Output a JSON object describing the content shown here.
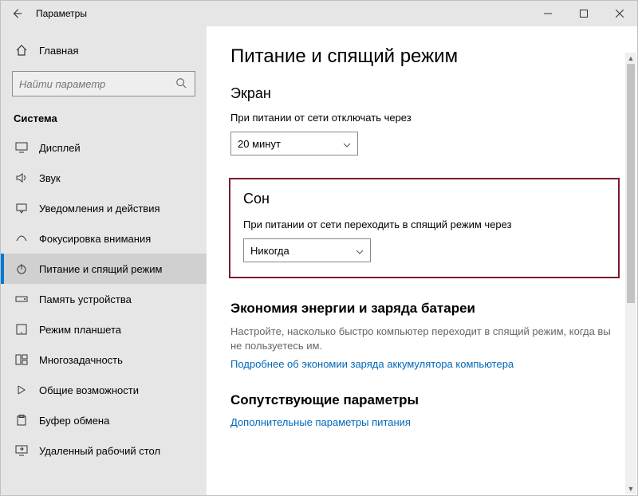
{
  "titlebar": {
    "title": "Параметры"
  },
  "sidebar": {
    "home": "Главная",
    "search_placeholder": "Найти параметр",
    "section": "Система",
    "items": [
      {
        "label": "Дисплей",
        "icon": "display-icon"
      },
      {
        "label": "Звук",
        "icon": "sound-icon"
      },
      {
        "label": "Уведомления и действия",
        "icon": "notifications-icon"
      },
      {
        "label": "Фокусировка внимания",
        "icon": "focus-icon"
      },
      {
        "label": "Питание и спящий режим",
        "icon": "power-icon"
      },
      {
        "label": "Память устройства",
        "icon": "storage-icon"
      },
      {
        "label": "Режим планшета",
        "icon": "tablet-icon"
      },
      {
        "label": "Многозадачность",
        "icon": "multitask-icon"
      },
      {
        "label": "Общие возможности",
        "icon": "shared-icon"
      },
      {
        "label": "Буфер обмена",
        "icon": "clipboard-icon"
      },
      {
        "label": "Удаленный рабочий стол",
        "icon": "remote-icon"
      }
    ]
  },
  "main": {
    "title": "Питание и спящий режим",
    "screen": {
      "heading": "Экран",
      "label": "При питании от сети отключать через",
      "value": "20 минут"
    },
    "sleep": {
      "heading": "Сон",
      "label": "При питании от сети переходить в спящий режим через",
      "value": "Никогда"
    },
    "battery": {
      "heading": "Экономия энергии и заряда батареи",
      "desc": "Настройте, насколько быстро компьютер переходит в спящий режим, когда вы не пользуетесь им.",
      "link": "Подробнее об экономии заряда аккумулятора компьютера"
    },
    "related": {
      "heading": "Сопутствующие параметры",
      "link": "Дополнительные параметры питания"
    }
  }
}
